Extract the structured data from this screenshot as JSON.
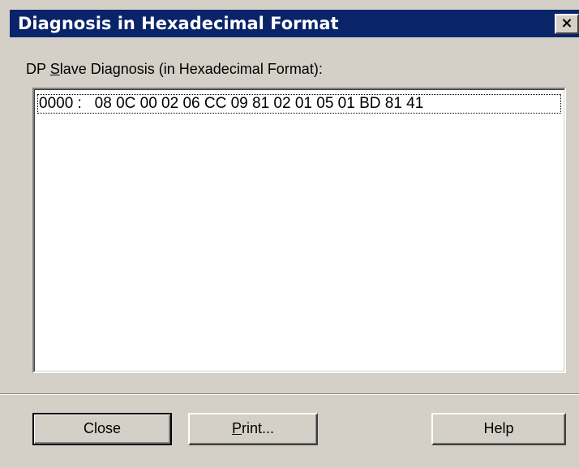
{
  "window": {
    "title": "Diagnosis in Hexadecimal Format",
    "close_glyph": "×"
  },
  "label": {
    "prefix": "DP ",
    "mnemonic": "S",
    "suffix": "lave Diagnosis (in Hexadecimal Format):"
  },
  "list": {
    "rows": [
      "0000 :   08 0C 00 02 06 CC 09 81 02 01 05 01 BD 81 41"
    ]
  },
  "buttons": {
    "close_label": "Close",
    "print_mnemonic": "P",
    "print_rest": "rint...",
    "help_label": "Help"
  },
  "colors": {
    "titlebar": "#0a246a",
    "face": "#d4d0c8"
  }
}
